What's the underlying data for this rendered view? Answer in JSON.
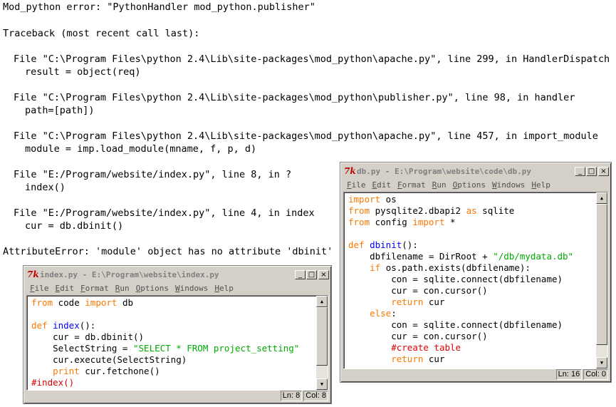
{
  "traceback": {
    "lines": [
      {
        "text": "Mod_python error: \"PythonHandler mod_python.publisher\""
      },
      {
        "text": "Traceback (most recent call last):"
      },
      {
        "text": "File \"C:\\Program Files\\python 2.4\\Lib\\site-packages\\mod_python\\apache.py\", line 299, in HandlerDispatch"
      },
      {
        "text": "result = object(req)"
      },
      {
        "text": "File \"C:\\Program Files\\python 2.4\\Lib\\site-packages\\mod_python\\publisher.py\", line 98, in handler"
      },
      {
        "text": "path=[path])"
      },
      {
        "text": "File \"C:\\Program Files\\python 2.4\\Lib\\site-packages\\mod_python\\apache.py\", line 457, in import_module"
      },
      {
        "text": "module = imp.load_module(mname, f, p, d)"
      },
      {
        "text": "File \"E:/Program/website/index.py\", line 8, in ?"
      },
      {
        "text": "index()"
      },
      {
        "text": "File \"E:/Program/website/index.py\", line 4, in index"
      },
      {
        "text": "cur = db.dbinit()"
      },
      {
        "text": "AttributeError: 'module' object has no attribute 'dbinit'"
      }
    ]
  },
  "menu_items": [
    "File",
    "Edit",
    "Format",
    "Run",
    "Options",
    "Windows",
    "Help"
  ],
  "window_buttons": {
    "minimize": "_",
    "maximize": "□",
    "close": "×"
  },
  "colors": {
    "keyword": "#ff7700",
    "string": "#00aa00",
    "definition": "#0000ff",
    "comment": "#dd0000"
  },
  "windows": {
    "index": {
      "title": "index.py - E:\\Program\\website\\index.py",
      "icon": "python-idle-icon",
      "status_line": "Ln: 8",
      "status_col": "Col: 8"
    },
    "db": {
      "title": "db.py - E:\\Program\\website\\code\\db.py",
      "icon": "python-idle-icon",
      "status_line": "Ln: 16",
      "status_col": "Col: 0"
    }
  },
  "index_code": [
    [
      {
        "t": "from",
        "c": "kw"
      },
      {
        "t": " code "
      },
      {
        "t": "import",
        "c": "kw"
      },
      {
        "t": " db"
      }
    ],
    [],
    [
      {
        "t": "def",
        "c": "kw"
      },
      {
        "t": " "
      },
      {
        "t": "index",
        "c": "def"
      },
      {
        "t": "():"
      }
    ],
    [
      {
        "t": "    cur = db.dbinit()"
      }
    ],
    [
      {
        "t": "    SelectString = "
      },
      {
        "t": "\"SELECT * FROM project_setting\"",
        "c": "str"
      }
    ],
    [
      {
        "t": "    cur.execute(SelectString)"
      }
    ],
    [
      {
        "t": "    "
      },
      {
        "t": "print",
        "c": "kw"
      },
      {
        "t": " cur.fetchone()"
      }
    ],
    [
      {
        "t": "#index()",
        "c": "cmt"
      }
    ]
  ],
  "db_code": [
    [
      {
        "t": "import",
        "c": "kw"
      },
      {
        "t": " os"
      }
    ],
    [
      {
        "t": "from",
        "c": "kw"
      },
      {
        "t": " pysqlite2.dbapi2 "
      },
      {
        "t": "as",
        "c": "kw"
      },
      {
        "t": " sqlite"
      }
    ],
    [
      {
        "t": "from",
        "c": "kw"
      },
      {
        "t": " config "
      },
      {
        "t": "import",
        "c": "kw"
      },
      {
        "t": " *"
      }
    ],
    [],
    [
      {
        "t": "def",
        "c": "kw"
      },
      {
        "t": " "
      },
      {
        "t": "dbinit",
        "c": "def"
      },
      {
        "t": "():"
      }
    ],
    [
      {
        "t": "    dbfilename = DirRoot + "
      },
      {
        "t": "\"/db/mydata.db\"",
        "c": "str"
      }
    ],
    [
      {
        "t": "    "
      },
      {
        "t": "if",
        "c": "kw"
      },
      {
        "t": " os.path.exists(dbfilename):"
      }
    ],
    [
      {
        "t": "        con = sqlite.connect(dbfilename)"
      }
    ],
    [
      {
        "t": "        cur = con.cursor()"
      }
    ],
    [
      {
        "t": "        "
      },
      {
        "t": "return",
        "c": "kw"
      },
      {
        "t": " cur"
      }
    ],
    [
      {
        "t": "    "
      },
      {
        "t": "else",
        "c": "kw"
      },
      {
        "t": ":"
      }
    ],
    [
      {
        "t": "        con = sqlite.connect(dbfilename)"
      }
    ],
    [
      {
        "t": "        cur = con.cursor()"
      }
    ],
    [
      {
        "t": "        "
      },
      {
        "t": "#create table",
        "c": "cmt"
      }
    ],
    [
      {
        "t": "        "
      },
      {
        "t": "return",
        "c": "kw"
      },
      {
        "t": " cur"
      }
    ]
  ]
}
